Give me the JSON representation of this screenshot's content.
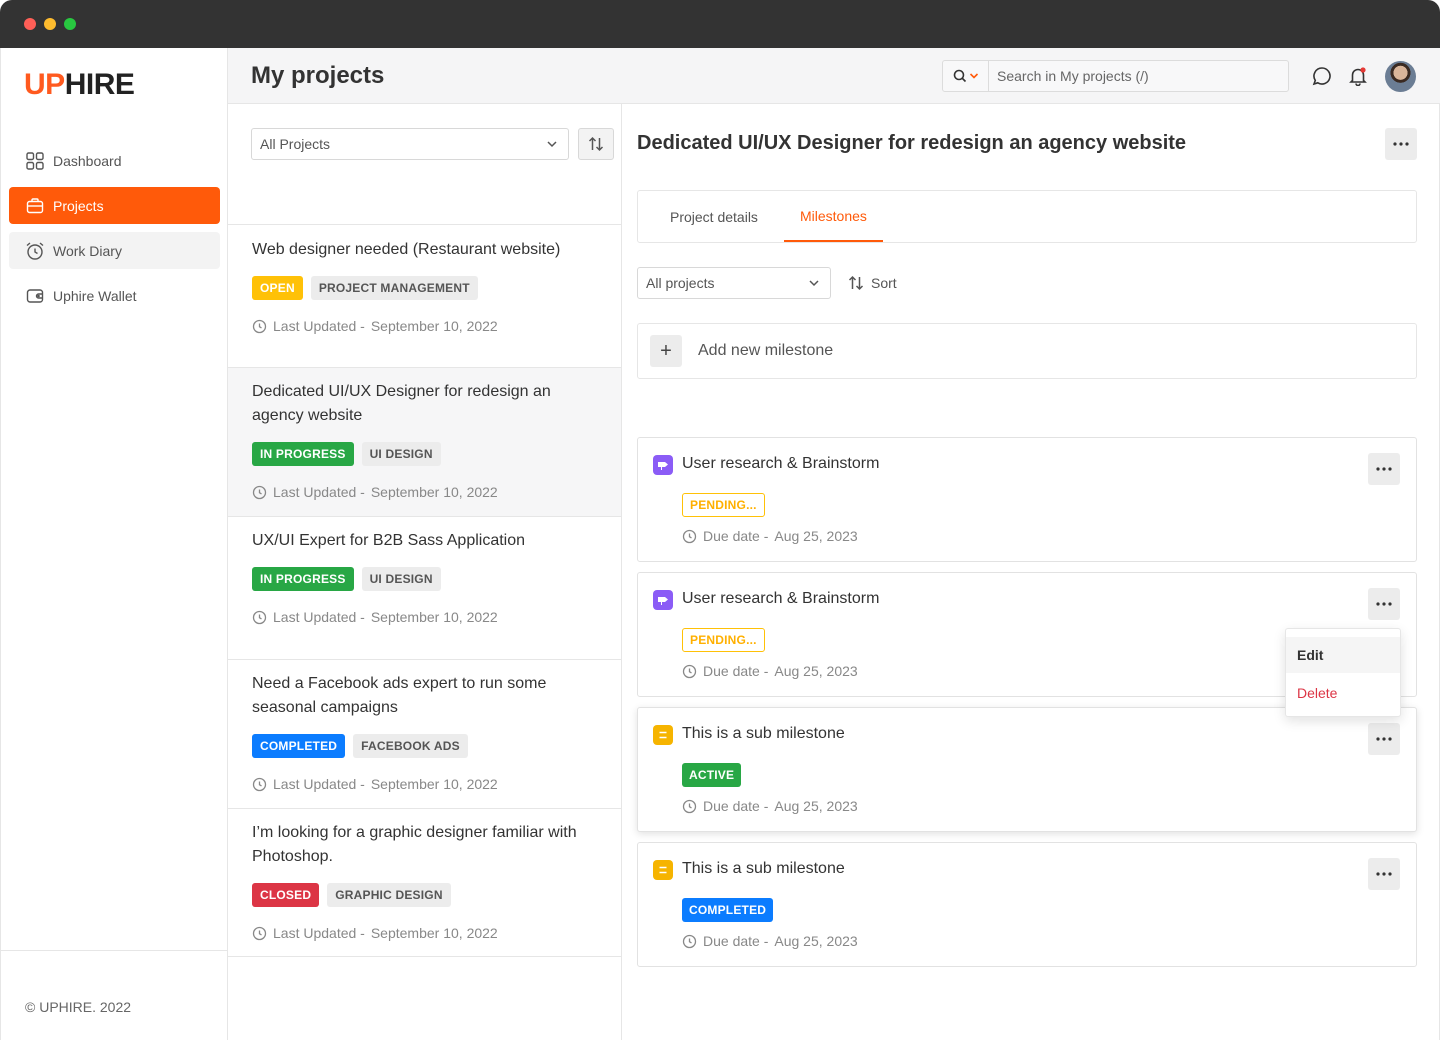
{
  "brand": {
    "logo_up": "UP",
    "logo_hire": "HIRE",
    "accent": "#ff5a0a"
  },
  "sidebar": {
    "items": [
      {
        "label": "Dashboard",
        "icon": "grid-icon"
      },
      {
        "label": "Projects",
        "icon": "briefcase-icon"
      },
      {
        "label": "Work Diary",
        "icon": "alarm-clock-icon"
      },
      {
        "label": "Uphire Wallet",
        "icon": "wallet-icon"
      }
    ],
    "active": "Projects",
    "copyright": "© UPHIRE. 2022"
  },
  "header": {
    "title": "My projects",
    "search_placeholder": "Search in My projects (/)"
  },
  "projects": {
    "filter": "All Projects",
    "updated_label": "Last Updated -",
    "items": [
      {
        "title": "Web designer needed (Restaurant website)",
        "status": "OPEN",
        "category": "PROJECT MANAGEMENT",
        "updated": "September 10, 2022"
      },
      {
        "title": "Dedicated UI/UX Designer for redesign an agency website",
        "status": "IN PROGRESS",
        "category": "UI DESIGN",
        "updated": "September 10, 2022"
      },
      {
        "title": "UX/UI Expert for B2B Sass Application",
        "status": "IN PROGRESS",
        "category": "UI DESIGN",
        "updated": "September 10, 2022"
      },
      {
        "title": "Need a Facebook ads expert to run some seasonal campaigns",
        "status": "COMPLETED",
        "category": "FACEBOOK ADS",
        "updated": "September 10, 2022"
      },
      {
        "title": "I’m looking for a graphic designer familiar with Photoshop.",
        "status": "CLOSED",
        "category": "GRAPHIC DESIGN",
        "updated": "September 10, 2022"
      }
    ]
  },
  "detail": {
    "title": "Dedicated UI/UX Designer for redesign an agency website",
    "tabs": [
      "Project details",
      "Milestones"
    ],
    "active_tab": "Milestones",
    "filter": "All projects",
    "sort_label": "Sort",
    "add_label": "Add new milestone",
    "due_label": "Due date -",
    "milestones": [
      {
        "title": "User research & Brainstorm",
        "status": "PENDING...",
        "due": "Aug 25, 2023",
        "icon": "signpost-icon"
      },
      {
        "title": "User research & Brainstorm",
        "status": "PENDING...",
        "due": "Aug 25, 2023",
        "icon": "signpost-icon"
      },
      {
        "title": "This is a sub milestone",
        "status": "ACTIVE",
        "due": "Aug 25, 2023",
        "icon": "sub-milestone-icon"
      },
      {
        "title": "This is a sub milestone",
        "status": "COMPLETED",
        "due": "Aug 25, 2023",
        "icon": "sub-milestone-icon"
      }
    ],
    "menu": {
      "edit": "Edit",
      "delete": "Delete"
    }
  }
}
